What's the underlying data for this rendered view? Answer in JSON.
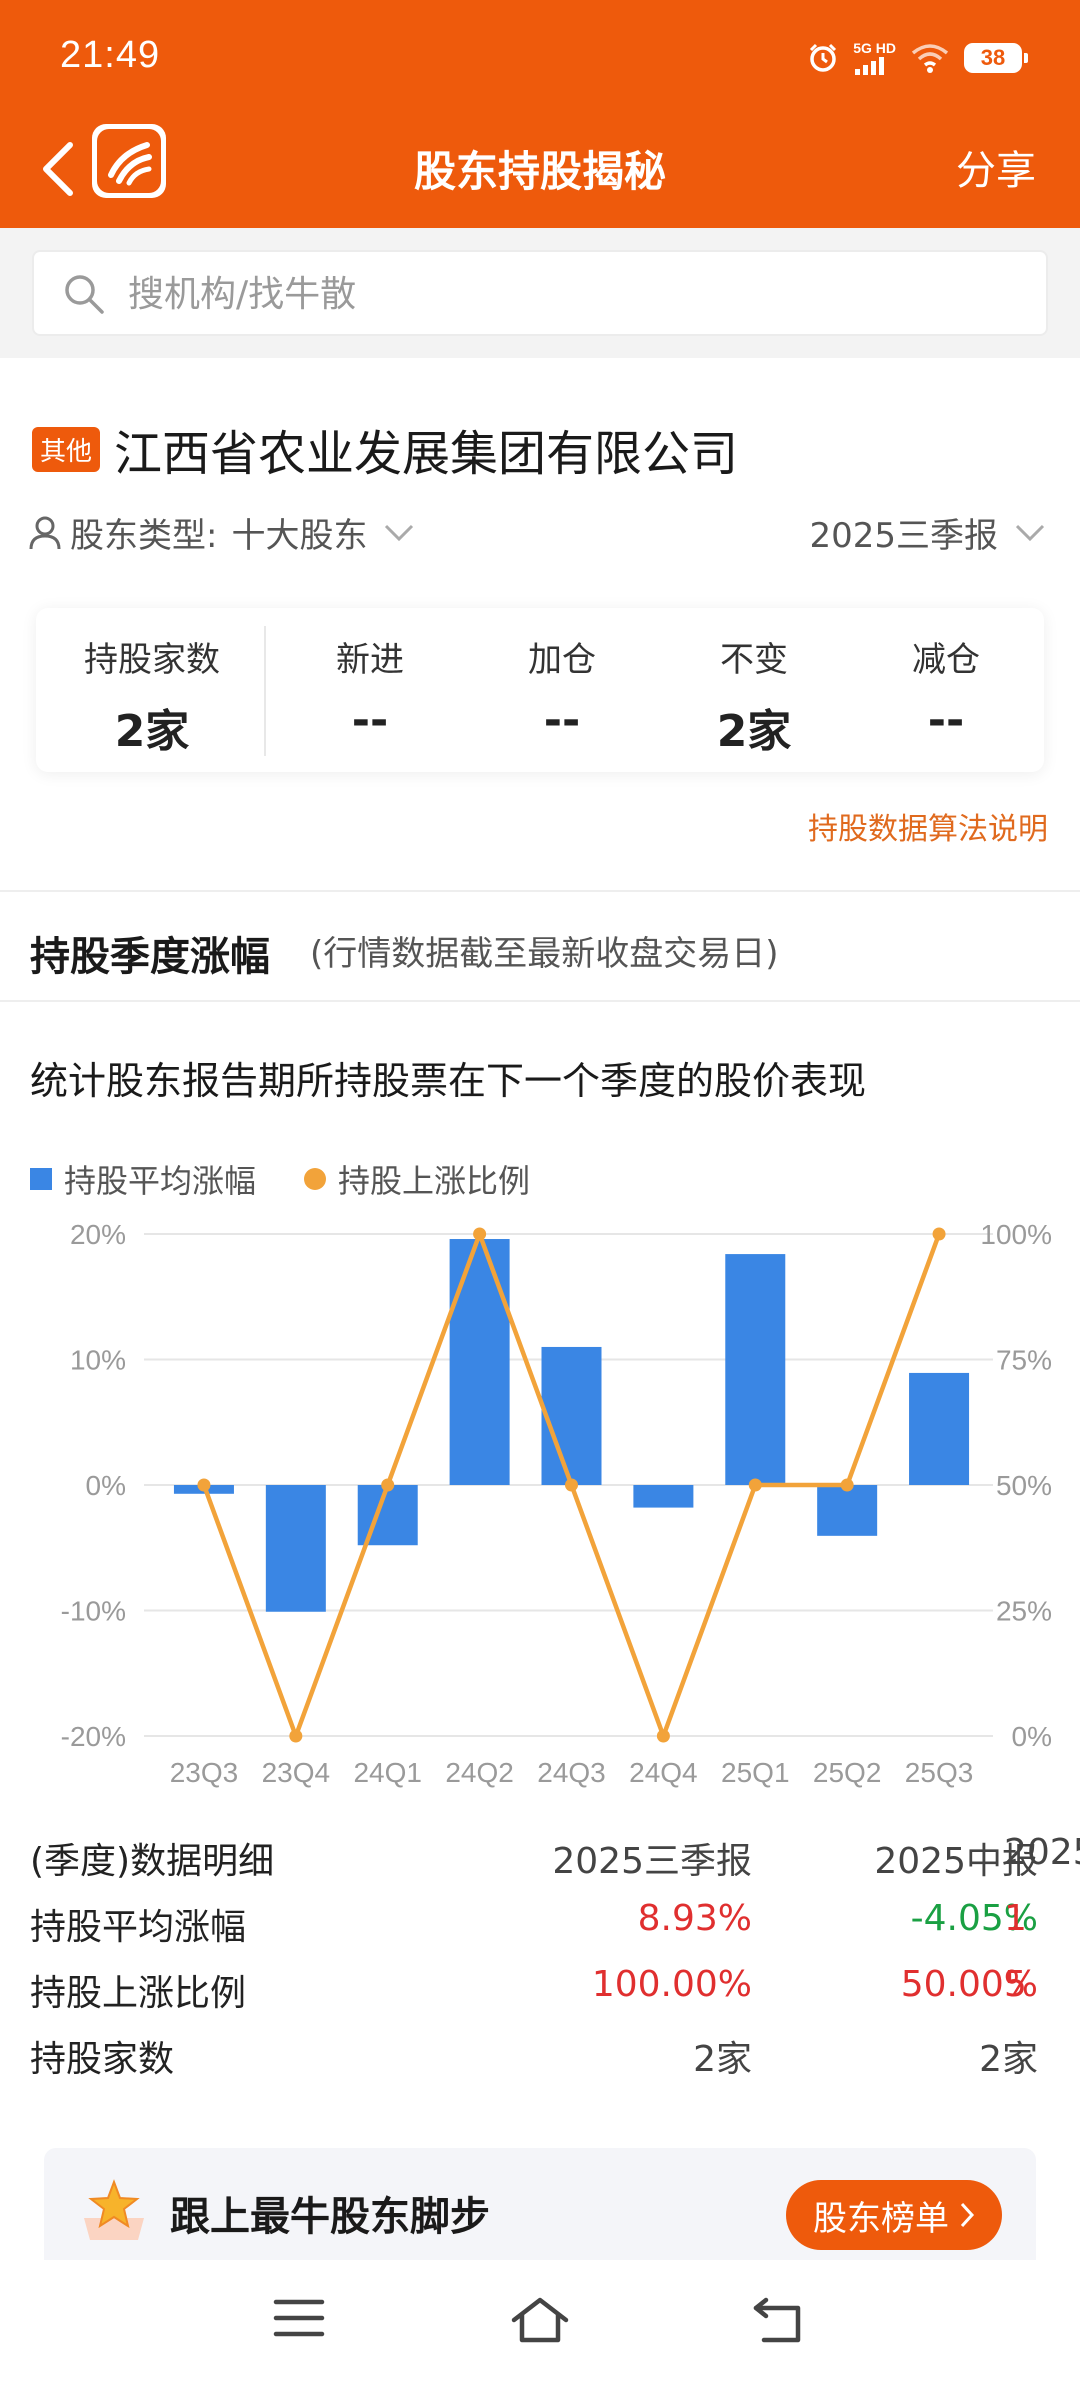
{
  "status_bar": {
    "time": "21:49",
    "network": "5G HD",
    "battery": "38"
  },
  "navbar": {
    "title": "股东持股揭秘",
    "share": "分享"
  },
  "search": {
    "placeholder": "搜机构/找牛散"
  },
  "company": {
    "tag": "其他",
    "name": "江西省农业发展集团有限公司"
  },
  "filters": {
    "type_label": "股东类型:",
    "type_value": "十大股东",
    "period": "2025三季报"
  },
  "stats": [
    {
      "label": "持股家数",
      "value": "2家"
    },
    {
      "label": "新进",
      "value": "--"
    },
    {
      "label": "加仓",
      "value": "--"
    },
    {
      "label": "不变",
      "value": "2家"
    },
    {
      "label": "减仓",
      "value": "--"
    }
  ],
  "algo_link": "持股数据算法说明",
  "section": {
    "title": "持股季度涨幅",
    "subtitle": "(行情数据截至最新收盘交易日)"
  },
  "chart_desc": "统计股东报告期所持股票在下一个季度的股价表现",
  "chart_data": {
    "type": "bar",
    "categories": [
      "23Q3",
      "23Q4",
      "24Q1",
      "24Q2",
      "24Q3",
      "24Q4",
      "25Q1",
      "25Q2",
      "25Q3"
    ],
    "series": [
      {
        "name": "持股平均涨幅",
        "type": "bar",
        "axis": "left",
        "color": "#3a86e4",
        "values": [
          -0.7,
          -10.1,
          -4.8,
          19.6,
          11.0,
          -1.8,
          18.4,
          -4.05,
          8.93
        ]
      },
      {
        "name": "持股上涨比例",
        "type": "line",
        "axis": "right",
        "color": "#f2a33a",
        "values": [
          50,
          0,
          50,
          100,
          50,
          0,
          50,
          50,
          100
        ]
      }
    ],
    "left_axis": {
      "ticks": [
        "20%",
        "10%",
        "0%",
        "-10%",
        "-20%"
      ],
      "ylim": [
        -20,
        20
      ]
    },
    "right_axis": {
      "ticks": [
        "100%",
        "75%",
        "50%",
        "25%",
        "0%"
      ],
      "ylim": [
        0,
        100
      ]
    },
    "grid": true,
    "legend": "top-left"
  },
  "table": {
    "header": [
      "(季度)数据明细",
      "2025三季报",
      "2025中报",
      "2025"
    ],
    "rows": [
      {
        "label": "持股平均涨幅",
        "values": [
          "8.93%",
          "-4.05%",
          "1"
        ]
      },
      {
        "label": "持股上涨比例",
        "values": [
          "100.00%",
          "50.00%",
          "5"
        ]
      },
      {
        "label": "持股家数",
        "values": [
          "2家",
          "2家",
          ""
        ]
      }
    ]
  },
  "promo": {
    "text": "跟上最牛股东脚步",
    "button": "股东榜单"
  }
}
